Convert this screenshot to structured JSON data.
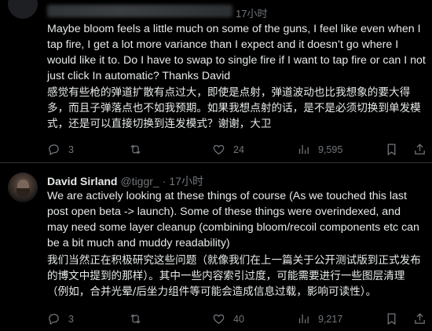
{
  "top_tweet": {
    "time": "17小时",
    "text_en": "Maybe bloom feels a little much on some of the guns, I feel like even when I tap fire, I get a lot more variance than I expect and it doesn’t go where I would like it to. Do I have to swap to single fire if I want to tap fire or can I not just click   In automatic? Thanks David",
    "text_cn": "感觉有些枪的弹道扩散有点过大，即使是点射，弹道波动也比我想象的要大得多，而且子弹落点也不如我预期。如果我想点射的话，是不是必须切换到单发模式，还是可以直接切换到连发模式？谢谢，大卫",
    "actions": {
      "reply": "3",
      "retweet": "",
      "like": "24",
      "views": "9,595"
    }
  },
  "reply_tweet": {
    "author_name": "David Sirland",
    "handle": "@tiggr_",
    "dot": "·",
    "time": "17小时",
    "text_en": "We are actively looking at these things of course (As we touched this last post open beta -> launch). Some of these things were overindexed, and may need some layer cleanup (combining bloom/recoil components etc can be a bit much and muddy readability)",
    "text_cn": "我们当然正在积极研究这些问题（就像我们在上一篇关于公开测试版到正式发布的博文中提到的那样）。其中一些内容索引过度，可能需要进行一些图层清理（例如，合并光晕/后坐力组件等可能会造成信息过载，影响可读性）。",
    "actions": {
      "reply": "3",
      "retweet": "",
      "like": "40",
      "views": "9,217"
    }
  },
  "colors": {
    "background": "#000000",
    "text": "#e7e9ea",
    "muted": "#71767b",
    "divider": "#2f3336"
  },
  "icons": [
    "reply-icon",
    "retweet-icon",
    "like-icon",
    "views-icon",
    "bookmark-icon",
    "share-icon"
  ]
}
